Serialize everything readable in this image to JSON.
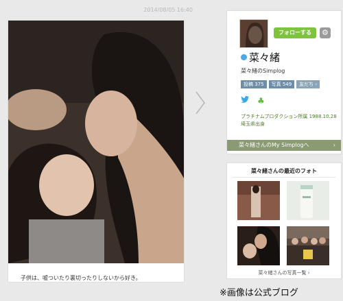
{
  "post": {
    "timestamp": "2014/08/05 16:40",
    "caption": "子供は、嘘ついたり裏切ったりしないから好き。"
  },
  "profile": {
    "follow_label": "フォローする",
    "gear_glyph": "⚙",
    "name": "菜々緒",
    "subtitle": "菜々緒のSimplog",
    "stats": {
      "posts": "投稿 375",
      "photos": "写真 549",
      "friends": "友だち ›"
    },
    "twitter_glyph": "🐦",
    "clover_glyph": "♣",
    "bio": "プラチナムプロダクション所属 1988.10.28 埼玉県出身",
    "my_simplog_link": "菜々緒さんのMy Simplogへ",
    "link_chevron": "›"
  },
  "recent": {
    "title": "菜々緒さんの最近のフォト",
    "all_photos_link": "菜々緒さんの写真一覧 ›"
  },
  "notice": "※画像は公式ブログ",
  "colors": {
    "follow": "#7dc33b",
    "link_bar": "#8a9a73",
    "stat": "#6d8ea8",
    "bio": "#4a7a22"
  }
}
